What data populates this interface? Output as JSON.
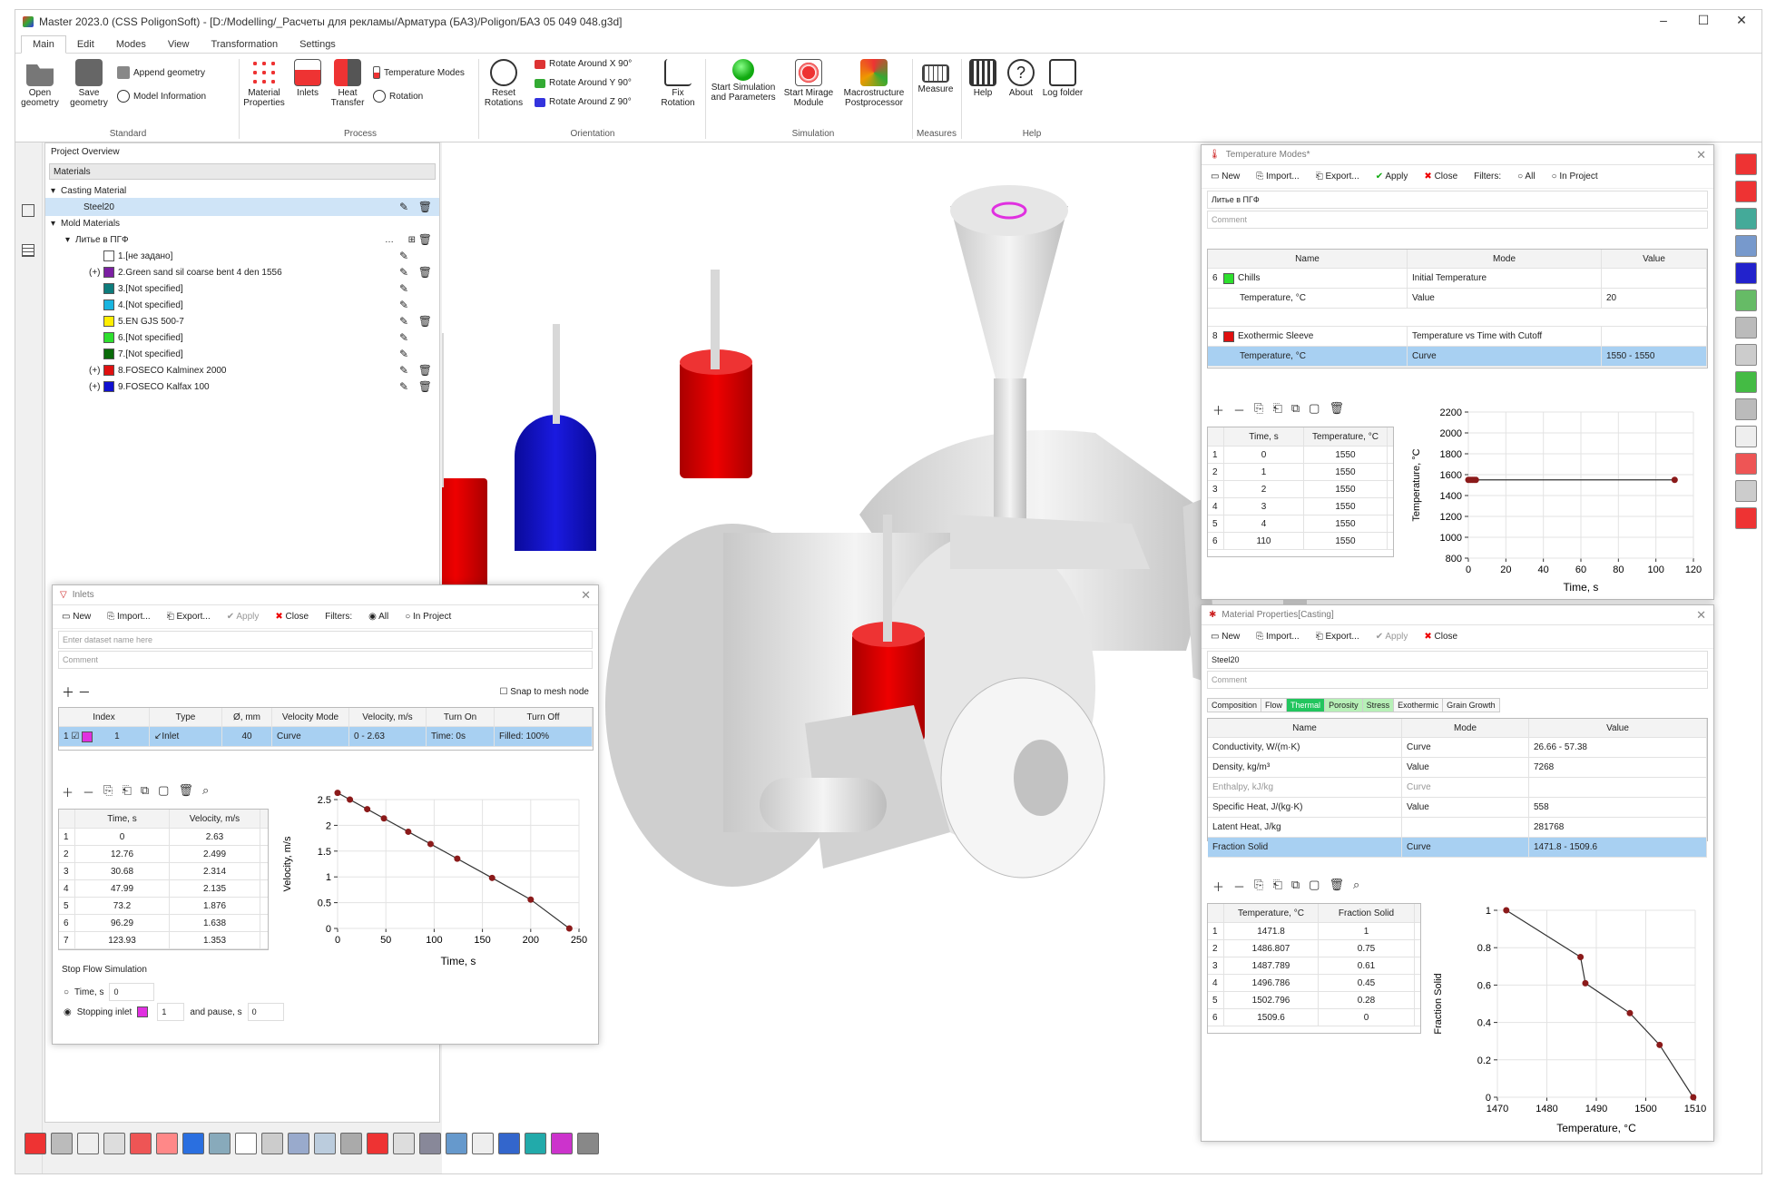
{
  "window": {
    "title": "Master 2023.0 (CSS PoligonSoft) - [D:/Modelling/_Расчеты для рекламы/Арматура (БАЗ)/Poligon/БАЗ 05 049 048.g3d]"
  },
  "ribbon_tabs": [
    "Main",
    "Edit",
    "Modes",
    "View",
    "Transformation",
    "Settings"
  ],
  "ribbon": {
    "open_geometry": "Open geometry",
    "save_geometry": "Save geometry",
    "append_geometry": "Append geometry",
    "model_information": "Model Information",
    "material_properties": "Material Properties",
    "inlets": "Inlets",
    "heat_transfer": "Heat Transfer",
    "temperature_modes": "Temperature Modes",
    "rotation": "Rotation",
    "reset_rotations": "Reset Rotations",
    "rotate_x": "Rotate Around X 90°",
    "rotate_y": "Rotate Around Y 90°",
    "rotate_z": "Rotate Around Z 90°",
    "fix_rotation": "Fix Rotation",
    "start_simulation": "Start Simulation and Parameters",
    "start_mirage": "Start Mirage Module",
    "macrostructure": "Macrostructure Postprocessor",
    "measure": "Measure",
    "help": "Help",
    "about": "About",
    "log_folder": "Log folder",
    "groups": {
      "standard": "Standard",
      "process": "Process",
      "orientation": "Orientation",
      "simulation": "Simulation",
      "measures": "Measures",
      "help": "Help"
    }
  },
  "project": {
    "title": "Project Overview",
    "header": "Materials",
    "casting_material": "Casting Material",
    "casting_item": "Steel20",
    "mold_materials": "Mold Materials",
    "mold_group": "Литье в ПГФ",
    "items": [
      {
        "label": "1.[не задано]",
        "color": "#ffffff",
        "prefix": "",
        "del": false
      },
      {
        "label": "2.Green sand sil coarse bent 4 den 1556",
        "color": "#7b1fa2",
        "prefix": "(+)",
        "del": true
      },
      {
        "label": "3.[Not specified]",
        "color": "#0d7c7c",
        "prefix": "",
        "del": false
      },
      {
        "label": "4.[Not specified]",
        "color": "#19b5e0",
        "prefix": "",
        "del": false
      },
      {
        "label": "5.EN GJS 500-7",
        "color": "#ffee00",
        "prefix": "",
        "del": true
      },
      {
        "label": "6.[Not specified]",
        "color": "#2ee02e",
        "prefix": "",
        "del": false
      },
      {
        "label": "7.[Not specified]",
        "color": "#0a6b0a",
        "prefix": "",
        "del": false
      },
      {
        "label": "8.FOSECO Kalminex 2000",
        "color": "#e01010",
        "prefix": "(+)",
        "del": true
      },
      {
        "label": "9.FOSECO Kalfax 100",
        "color": "#1010d0",
        "prefix": "(+)",
        "del": true
      }
    ]
  },
  "inlets": {
    "title": "Inlets",
    "toolbar": {
      "new": "New",
      "import": "Import...",
      "export": "Export...",
      "apply": "Apply",
      "close": "Close",
      "filters": "Filters:",
      "all": "All",
      "in_project": "In Project"
    },
    "name_placeholder": "Enter dataset name here",
    "comment_placeholder": "Comment",
    "snap": "Snap to mesh node",
    "columns": [
      "Index",
      "Type",
      "Ø, mm",
      "Velocity Mode",
      "Velocity, m/s",
      "Turn On",
      "Turn Off"
    ],
    "row": {
      "num": "1",
      "index": "1",
      "type": "Inlet",
      "d": "40",
      "mode": "Curve",
      "vel": "0 - 2.63",
      "on": "Time: 0s",
      "off": "Filled: 100%"
    },
    "curve_cols": [
      "Time, s",
      "Velocity, m/s"
    ],
    "curve_rows": [
      [
        "0",
        "2.63"
      ],
      [
        "12.76",
        "2.499"
      ],
      [
        "30.68",
        "2.314"
      ],
      [
        "47.99",
        "2.135"
      ],
      [
        "73.2",
        "1.876"
      ],
      [
        "96.29",
        "1.638"
      ],
      [
        "123.93",
        "1.353"
      ]
    ],
    "stop_flow": "Stop Flow Simulation",
    "time_s": "Time, s",
    "time_val": "0",
    "stopping_inlet": "Stopping inlet",
    "stop_inlet_num": "1",
    "and_pause": "and pause, s",
    "pause_val": "0"
  },
  "temp_modes": {
    "title": "Temperature Modes*",
    "toolbar": {
      "new": "New",
      "import": "Import...",
      "export": "Export...",
      "apply": "Apply",
      "close": "Close",
      "filters": "Filters:",
      "all": "All",
      "in_project": "In Project"
    },
    "name_value": "Литье в ПГФ",
    "comment_placeholder": "Comment",
    "columns": [
      "Name",
      "Mode",
      "Value"
    ],
    "rows": [
      {
        "num": "6",
        "name": "Chills",
        "color": "#2ee02e",
        "mode": "Initial Temperature",
        "value": ""
      },
      {
        "num": "",
        "name": "Temperature, °C",
        "color": "",
        "mode": "Value",
        "value": "20"
      },
      {
        "num": "8",
        "name": "Exothermic Sleeve",
        "color": "#e01010",
        "mode": "Temperature vs Time with Cutoff",
        "value": ""
      },
      {
        "num": "",
        "name": "Temperature, °C",
        "color": "",
        "mode": "Curve",
        "value": "1550 - 1550"
      }
    ],
    "curve_cols": [
      "Time, s",
      "Temperature, °C"
    ],
    "curve_rows": [
      [
        "0",
        "1550"
      ],
      [
        "1",
        "1550"
      ],
      [
        "2",
        "1550"
      ],
      [
        "3",
        "1550"
      ],
      [
        "4",
        "1550"
      ],
      [
        "110",
        "1550"
      ]
    ]
  },
  "mat_props": {
    "title": "Material Properties[Casting]",
    "toolbar": {
      "new": "New",
      "import": "Import...",
      "export": "Export...",
      "apply": "Apply",
      "close": "Close"
    },
    "name_value": "Steel20",
    "comment_placeholder": "Comment",
    "tabs": [
      "Composition",
      "Flow",
      "Thermal",
      "Porosity",
      "Stress",
      "Exothermic",
      "Grain Growth"
    ],
    "columns": [
      "Name",
      "Mode",
      "Value"
    ],
    "rows": [
      {
        "name": "Conductivity, W/(m·K)",
        "mode": "Curve",
        "value": "26.66 - 57.38"
      },
      {
        "name": "Density, kg/m³",
        "mode": "Value",
        "value": "7268"
      },
      {
        "name": "Enthalpy, kJ/kg",
        "mode": "Curve",
        "value": ""
      },
      {
        "name": "Specific Heat, J/(kg·K)",
        "mode": "Value",
        "value": "558"
      },
      {
        "name": "Latent Heat, J/kg",
        "mode": "",
        "value": "281768"
      },
      {
        "name": "Fraction Solid",
        "mode": "Curve",
        "value": "1471.8 - 1509.6"
      }
    ],
    "curve_cols": [
      "Temperature, °C",
      "Fraction Solid"
    ],
    "curve_rows": [
      [
        "1471.8",
        "1"
      ],
      [
        "1486.807",
        "0.75"
      ],
      [
        "1487.789",
        "0.61"
      ],
      [
        "1496.786",
        "0.45"
      ],
      [
        "1502.796",
        "0.28"
      ],
      [
        "1509.6",
        "0"
      ]
    ]
  },
  "chart_data": [
    {
      "type": "line",
      "xlabel": "Time, s",
      "ylabel": "Velocity, m/s",
      "xlim": [
        0,
        250
      ],
      "ylim": [
        0,
        2.5
      ],
      "x": [
        0,
        12.76,
        30.68,
        47.99,
        73.2,
        96.29,
        123.93,
        160,
        200,
        240
      ],
      "y": [
        2.63,
        2.499,
        2.314,
        2.135,
        1.876,
        1.638,
        1.353,
        0.98,
        0.56,
        0
      ],
      "xticks": [
        "0",
        "50",
        "100",
        "150",
        "200",
        "250"
      ],
      "yticks": [
        "0",
        "0.5",
        "1",
        "1.5",
        "2",
        "2.5"
      ]
    },
    {
      "type": "line",
      "xlabel": "Time, s",
      "ylabel": "Temperature, °C",
      "xlim": [
        0,
        120
      ],
      "ylim": [
        800,
        2200
      ],
      "x": [
        0,
        1,
        2,
        3,
        4,
        110
      ],
      "y": [
        1550,
        1550,
        1550,
        1550,
        1550,
        1550
      ],
      "xticks": [
        "0",
        "20",
        "40",
        "60",
        "80",
        "100",
        "120"
      ],
      "yticks": [
        "800",
        "1000",
        "1200",
        "1400",
        "1600",
        "1800",
        "2000",
        "2200"
      ]
    },
    {
      "type": "line",
      "xlabel": "Temperature, °C",
      "ylabel": "Fraction Solid",
      "xlim": [
        1470,
        1510
      ],
      "ylim": [
        0,
        1
      ],
      "x": [
        1471.8,
        1486.807,
        1487.789,
        1496.786,
        1502.796,
        1509.6
      ],
      "y": [
        1,
        0.75,
        0.61,
        0.45,
        0.28,
        0
      ],
      "xticks": [
        "1470",
        "1480",
        "1490",
        "1500",
        "1510"
      ],
      "yticks": [
        "0",
        "0.2",
        "0.4",
        "0.6",
        "0.8",
        "1"
      ]
    }
  ]
}
